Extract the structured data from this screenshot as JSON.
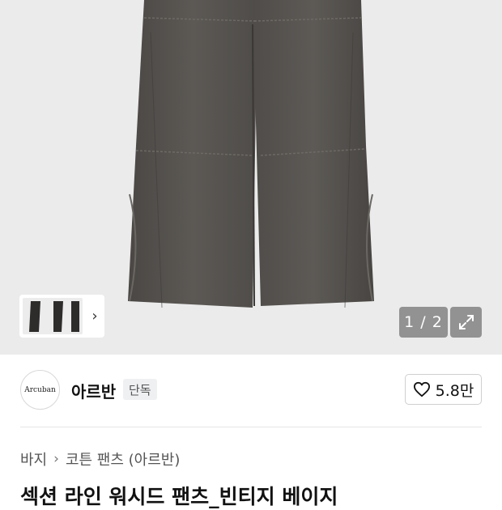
{
  "gallery": {
    "counter": "1 / 2",
    "thumbnail_next_label": "›"
  },
  "brand": {
    "logo_text": "Arcuban",
    "name": "아르반",
    "badge": "단독",
    "like_count": "5.8만"
  },
  "breadcrumb": {
    "items": [
      "바지",
      "코튼 팬츠 (아르반)"
    ]
  },
  "product": {
    "title": "섹션 라인 워시드 팬츠_빈티지 베이지"
  },
  "icons": {
    "expand": "expand-icon",
    "heart": "heart-outline-icon",
    "chevron": "chevron-right-icon"
  },
  "colors": {
    "hero_bg": "#ebebeb",
    "pants": "#55524f",
    "overlay": "#787878"
  }
}
